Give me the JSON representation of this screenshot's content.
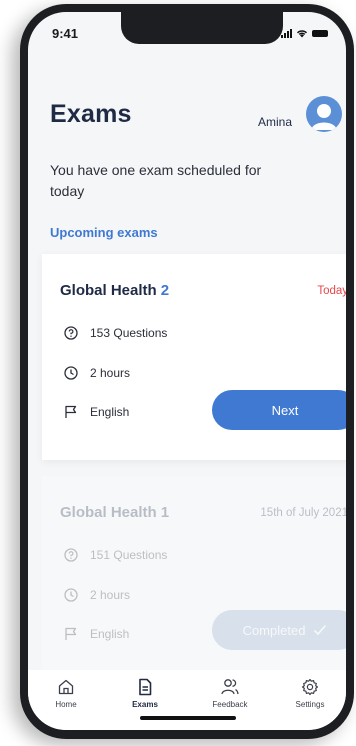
{
  "status_bar": {
    "time": "9:41"
  },
  "header": {
    "title": "Exams",
    "username": "Amina"
  },
  "subtitle": "You have one exam scheduled for today",
  "section_label": "Upcoming exams",
  "exams": [
    {
      "title": "Global Health",
      "number": "2",
      "date": "Today",
      "questions": "153 Questions",
      "duration": "2 hours",
      "language": "English",
      "action_label": "Next"
    },
    {
      "title": "Global Health",
      "number": "1",
      "date": "15th of July 2021",
      "questions": "151 Questions",
      "duration": "2 hours",
      "language": "English",
      "action_label": "Completed"
    }
  ],
  "tabbar": {
    "items": [
      {
        "label": "Home",
        "icon": "home-icon"
      },
      {
        "label": "Exams",
        "icon": "document-icon"
      },
      {
        "label": "Feedback",
        "icon": "users-icon"
      },
      {
        "label": "Settings",
        "icon": "gear-icon"
      }
    ],
    "active": "Exams"
  },
  "colors": {
    "accent": "#3f79d1",
    "today": "#e5484d",
    "title": "#1f2a44"
  }
}
